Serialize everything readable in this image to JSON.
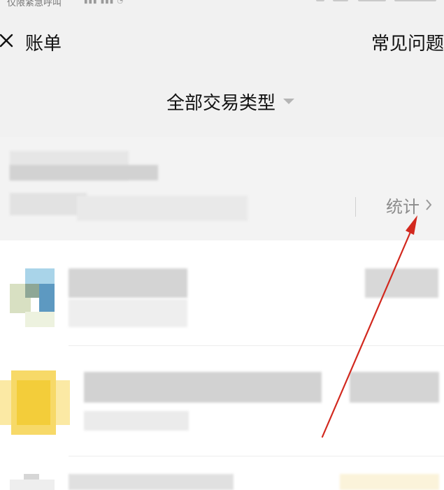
{
  "status_bar": {
    "left_text": "仅限紧急呼叫"
  },
  "header": {
    "title": "账单",
    "faq_label": "常见问题"
  },
  "filter": {
    "label": "全部交易类型"
  },
  "summary": {
    "stats_label": "统计"
  },
  "icons": {
    "close": "close-icon",
    "dropdown": "chevron-down-icon",
    "stats_arrow": "chevron-right-icon",
    "annotation": "red-arrow-annotation"
  },
  "colors": {
    "header_background": "#f1f1f1",
    "annotation": "#d2281e",
    "muted_text": "#8c8c8c"
  }
}
